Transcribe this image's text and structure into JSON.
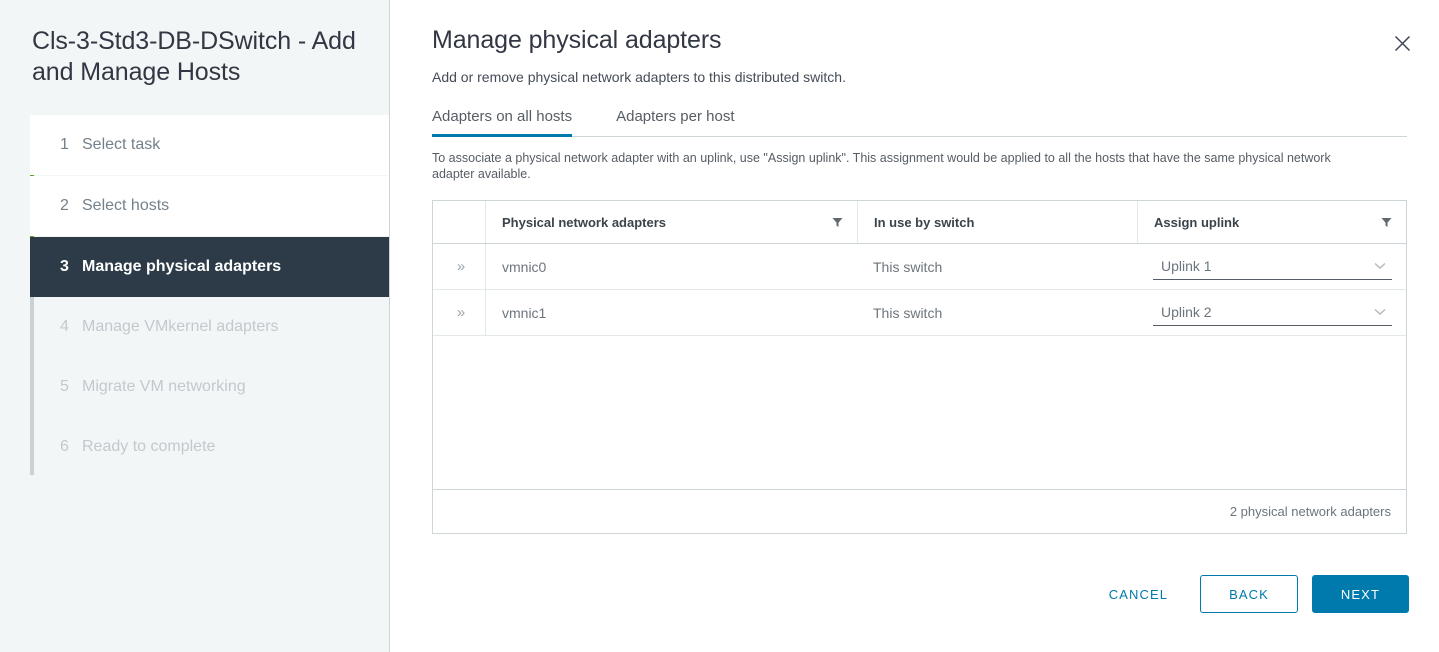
{
  "sidebar": {
    "title": "Cls-3-Std3-DB-DSwitch - Add and Manage Hosts",
    "steps": [
      {
        "num": "1",
        "label": "Select task",
        "state": "done"
      },
      {
        "num": "2",
        "label": "Select hosts",
        "state": "done"
      },
      {
        "num": "3",
        "label": "Manage physical adapters",
        "state": "active"
      },
      {
        "num": "4",
        "label": "Manage VMkernel adapters",
        "state": "todo"
      },
      {
        "num": "5",
        "label": "Migrate VM networking",
        "state": "todo"
      },
      {
        "num": "6",
        "label": "Ready to complete",
        "state": "todo"
      }
    ]
  },
  "main": {
    "title": "Manage physical adapters",
    "subtitle": "Add or remove physical network adapters to this distributed switch.",
    "close_icon": "close-icon",
    "tabs": [
      {
        "label": "Adapters on all hosts",
        "active": true
      },
      {
        "label": "Adapters per host",
        "active": false
      }
    ],
    "hint": "To associate a physical network adapter with an uplink, use \"Assign uplink\". This assignment would be applied to all the hosts that have the same physical network adapter available.",
    "table": {
      "columns": [
        {
          "label": "",
          "filter": false
        },
        {
          "label": "Physical network adapters",
          "filter": true
        },
        {
          "label": "In use by switch",
          "filter": false
        },
        {
          "label": "Assign uplink",
          "filter": true
        }
      ],
      "expand_icon": "»",
      "filter_icon": "filter-icon",
      "rows": [
        {
          "adapter": "vmnic0",
          "in_use_by_switch": "This switch",
          "assign_uplink": "Uplink 1"
        },
        {
          "adapter": "vmnic1",
          "in_use_by_switch": "This switch",
          "assign_uplink": "Uplink 2"
        }
      ],
      "footer_count": "2 physical network adapters"
    }
  },
  "actions": {
    "cancel_label": "CANCEL",
    "back_label": "BACK",
    "next_label": "NEXT"
  },
  "colors": {
    "accent_blue": "#0079ad",
    "completed_green": "#5aa220",
    "active_step_bg": "#2c3b47",
    "sidebar_bg": "#f3f6f7"
  }
}
